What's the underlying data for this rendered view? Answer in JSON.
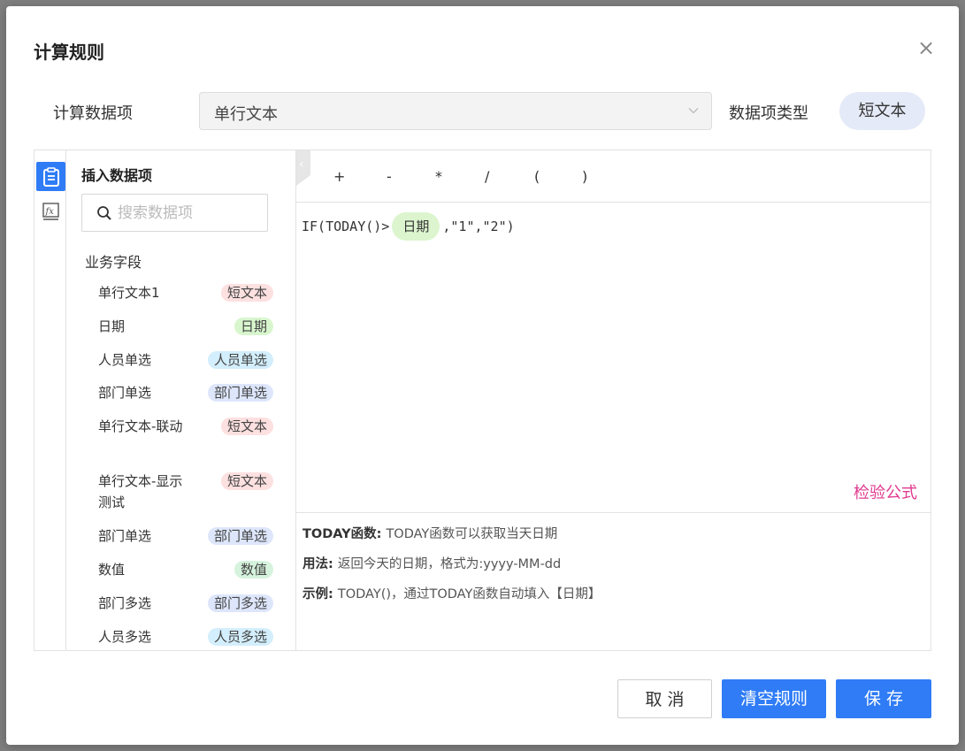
{
  "dialog": {
    "title": "计算规则",
    "close_symbol": "×"
  },
  "calc_field": {
    "label": "计算数据项",
    "selected": "单行文本",
    "type_label": "数据项类型",
    "type_value": "短文本"
  },
  "sidebar_tabs": [
    {
      "icon": "clipboard-icon",
      "active": true
    },
    {
      "icon": "function-icon",
      "active": false
    }
  ],
  "field_list": {
    "title": "插入数据项",
    "search_placeholder": "搜索数据项",
    "group_label": "业务字段",
    "items": [
      {
        "label": "单行文本1",
        "tag": "短文本",
        "tag_kind": "short"
      },
      {
        "label": "日期",
        "tag": "日期",
        "tag_kind": "date"
      },
      {
        "label": "人员单选",
        "tag": "人员单选",
        "tag_kind": "person"
      },
      {
        "label": "部门单选",
        "tag": "部门单选",
        "tag_kind": "dept"
      },
      {
        "label": "单行文本-联动",
        "tag": "短文本",
        "tag_kind": "short"
      },
      {
        "label": "单行文本-显示测试",
        "tag": "短文本",
        "tag_kind": "short"
      },
      {
        "label": "部门单选",
        "tag": "部门单选",
        "tag_kind": "dept"
      },
      {
        "label": "数值",
        "tag": "数值",
        "tag_kind": "num"
      },
      {
        "label": "部门多选",
        "tag": "部门多选",
        "tag_kind": "dept"
      },
      {
        "label": "人员多选",
        "tag": "人员多选",
        "tag_kind": "person"
      }
    ]
  },
  "editor": {
    "operators": [
      "+",
      "-",
      "*",
      "/",
      "(",
      ")"
    ],
    "formula_prefix": "IF(TODAY()>",
    "formula_chip": "日期",
    "formula_suffix": ",\"1\",\"2\")",
    "validate_label": "检验公式",
    "help": {
      "func_title": "TODAY函数",
      "func_desc": "TODAY函数可以获取当天日期",
      "usage_title": "用法",
      "usage_desc": "返回今天的日期，格式为:yyyy-MM-dd",
      "example_title": "示例",
      "example_desc": "TODAY()，通过TODAY函数自动填入【日期】"
    }
  },
  "footer": {
    "cancel": "取 消",
    "clear": "清空规则",
    "save": "保 存"
  },
  "colors": {
    "primary": "#2f7cf6",
    "validate": "#e03a8f",
    "date_chip": "#dcf5ce"
  }
}
